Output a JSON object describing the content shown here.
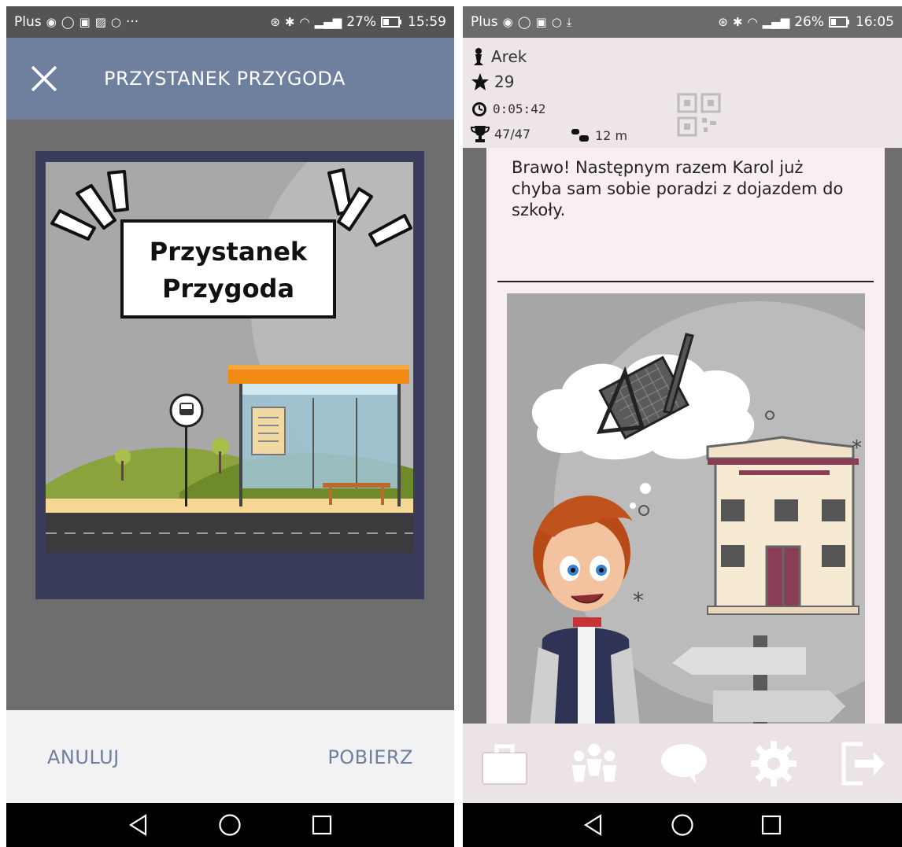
{
  "left": {
    "status": {
      "carrier": "Plus",
      "more": "···",
      "battery": "27%",
      "time": "15:59"
    },
    "title": "PRZYSTANEK PRZYGODA",
    "sign": {
      "line1": "Przystanek",
      "line2": "Przygoda"
    },
    "actions": {
      "cancel": "ANULUJ",
      "download": "POBIERZ"
    },
    "colors": {
      "header": "#6f7f9e",
      "poster_frame": "#393c5a",
      "action_text": "#6f7f9e"
    }
  },
  "right": {
    "status": {
      "carrier": "Plus",
      "battery": "26%",
      "time": "16:05"
    },
    "hud": {
      "player": "Arek",
      "score": "29",
      "timer": "0:05:42",
      "progress": "47/47",
      "distance": "12 m"
    },
    "message": "Brawo! Następnym razem Karol już chyba sam sobie poradzi z dojazdem do szkoły.",
    "toolbar_icons": [
      "briefcase-icon",
      "people-icon",
      "chat-bubble-icon",
      "gear-icon",
      "exit-icon"
    ],
    "colors": {
      "hud_bg": "#ede5e6",
      "card_bg": "#f8eef3",
      "toolbar_bg": "#ebe3e4"
    }
  }
}
